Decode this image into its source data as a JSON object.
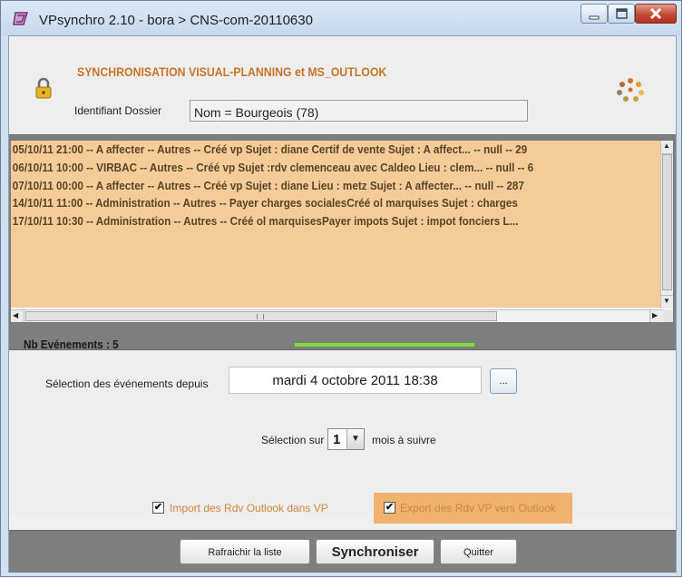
{
  "window": {
    "title": "VPsynchro 2.10 - bora > CNS-com-20110630"
  },
  "header": {
    "title": "SYNCHRONISATION VISUAL-PLANNING et MS_OUTLOOK",
    "id_label": "Identifiant Dossier",
    "id_value": "Nom = Bourgeois  (78)"
  },
  "events": {
    "rows": [
      "05/10/11 21:00 -- A affecter -- Autres -- Créé vp Sujet : diane Certif de vente  Sujet : A affect... -- null -- 29",
      "06/10/11 10:00 -- VIRBAC -- Autres -- Créé vp Sujet :rdv clemenceau avec Caldeo Lieu : clem... -- null -- 6",
      "07/10/11 00:00 -- A affecter -- Autres -- Créé vp Sujet : diane  Lieu : metz  Sujet : A affecter... -- null -- 287",
      "14/10/11 11:00 -- Administration -- Autres -- Payer charges socialesCréé ol marquises  Sujet : charges",
      "17/10/11 10:30 -- Administration -- Autres -- Créé ol marquisesPayer impots  Sujet : impot fonciers  L..."
    ],
    "count_label": "Nb Evénements : 5",
    "progress_fraction": 1.0
  },
  "options": {
    "since_label": "Sélection des événements depuis",
    "since_date": "mardi 4 octobre 2011  18:38",
    "date_button_label": "...",
    "selection_label": "Sélection sur",
    "months_value": "1",
    "months_after_label": "mois à suivre",
    "import_label": "Import des Rdv Outlook dans VP",
    "import_checked": true,
    "export_label": "Export des Rdv VP vers Outlook",
    "export_checked": true,
    "accent_color": "#f0b26e",
    "label_color": "#d1873d"
  },
  "footer": {
    "refresh_label": "Rafraichir la liste",
    "sync_label": "Synchroniser",
    "quit_label": "Quitter"
  }
}
